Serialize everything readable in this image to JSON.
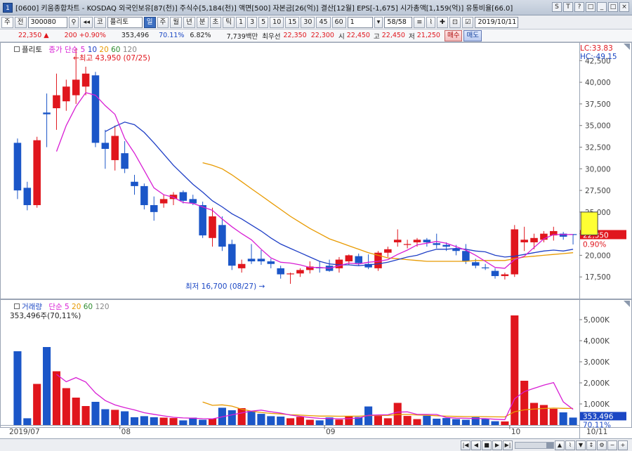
{
  "window": {
    "title": "[0600] 키움종합차트 - KOSDAQ 외국인보유[87(천)] 주식수[5,184(천)] 액면[500] 자본금[26(억)] 결산[12월] EPS[-1,675] 시가총액[1,159(억)] 유통비율[66.0]",
    "icon_label": "1",
    "controls": [
      "S",
      "T",
      "?",
      "□",
      "_",
      "□",
      "×"
    ]
  },
  "toolbar1": {
    "mode": "주",
    "market": "전",
    "code": "300080",
    "name_prefix": "코",
    "name": "플리토",
    "periods": [
      "일",
      "주",
      "월",
      "년",
      "분",
      "초",
      "틱"
    ],
    "active_period": "일",
    "intervals": [
      "1",
      "3",
      "5",
      "10",
      "15",
      "30",
      "45",
      "60"
    ],
    "custom_interval": "1",
    "count": "58/58",
    "date": "2019/10/11"
  },
  "toolbar2": {
    "price": "22,350",
    "change_arrow": "▲",
    "change": "200",
    "change_pct": "+0.90%",
    "volume": "353,496",
    "volume_ratio": "70.11%",
    "turnover": "6.82%",
    "amount": "7,739백만",
    "best_ask_label": "최우선",
    "best_ask": "22,350",
    "best_bid": "22,300",
    "open_label": "시",
    "open": "22,450",
    "high_label": "고",
    "high": "22,450",
    "low_label": "저",
    "low": "21,250",
    "buy_label": "매수",
    "sell_label": "매도"
  },
  "price_legend": {
    "name": "플리토",
    "series_title": "종가 단순",
    "periods": [
      "5",
      "10",
      "20",
      "60",
      "120"
    ],
    "period_colors": [
      "#d81ed4",
      "#1f3fc6",
      "#e89a00",
      "#2e8b2e",
      "#888888"
    ],
    "lc": "LC:33.83",
    "hc": "HC:-49.15",
    "high_note": "최고 43,950 (07/25)",
    "low_note": "최저 16,700 (08/27)",
    "last_price": "22,350",
    "last_pct": "0.90%"
  },
  "volume_legend": {
    "title": "거래량",
    "series_title": "단순",
    "periods": [
      "5",
      "20",
      "60",
      "120"
    ],
    "period_colors": [
      "#d81ed4",
      "#e89a00",
      "#2e8b2e",
      "#888888"
    ],
    "current": "353,496주(70,11%)",
    "last_volume": "353,496",
    "last_pct": "70.11%"
  },
  "x_axis": {
    "labels": [
      "2019/07",
      "08",
      "09",
      "10"
    ],
    "last_date": "10/11"
  },
  "chart_data": {
    "type": "candlestick",
    "price_axis": {
      "min": 15000,
      "max": 43500,
      "ticks": [
        17500,
        20000,
        22500,
        25000,
        27500,
        30000,
        32500,
        35000,
        37500,
        40000,
        42500
      ]
    },
    "volume_axis": {
      "min": 0,
      "max": 5500,
      "unit": "K",
      "ticks": [
        1000,
        2000,
        3000,
        4000,
        5000
      ],
      "tick_labels": [
        "1,000K",
        "2,000K",
        "3,000K",
        "4,000K",
        "5,000K"
      ]
    },
    "candles": [
      {
        "o": 33000,
        "h": 33500,
        "l": 26500,
        "c": 27500
      },
      {
        "o": 27800,
        "h": 28500,
        "l": 25200,
        "c": 25800
      },
      {
        "o": 25800,
        "h": 33700,
        "l": 25500,
        "c": 33300
      },
      {
        "o": 36500,
        "h": 38700,
        "l": 32500,
        "c": 36300
      },
      {
        "o": 37000,
        "h": 41000,
        "l": 34500,
        "c": 38500
      },
      {
        "o": 37800,
        "h": 40300,
        "l": 36700,
        "c": 39500
      },
      {
        "o": 38500,
        "h": 43950,
        "l": 37500,
        "c": 40300
      },
      {
        "o": 39500,
        "h": 41800,
        "l": 38500,
        "c": 41000
      },
      {
        "o": 40800,
        "h": 41200,
        "l": 32500,
        "c": 33000
      },
      {
        "o": 33000,
        "h": 34500,
        "l": 30000,
        "c": 32300
      },
      {
        "o": 31000,
        "h": 35000,
        "l": 29800,
        "c": 33800
      },
      {
        "o": 31800,
        "h": 33200,
        "l": 29500,
        "c": 30000
      },
      {
        "o": 28500,
        "h": 29300,
        "l": 27000,
        "c": 28000
      },
      {
        "o": 28000,
        "h": 28300,
        "l": 25300,
        "c": 25800
      },
      {
        "o": 25800,
        "h": 26800,
        "l": 24000,
        "c": 25000
      },
      {
        "o": 26000,
        "h": 27000,
        "l": 25500,
        "c": 26500
      },
      {
        "o": 26500,
        "h": 27300,
        "l": 25800,
        "c": 27000
      },
      {
        "o": 27300,
        "h": 27500,
        "l": 26000,
        "c": 26300
      },
      {
        "o": 26500,
        "h": 27000,
        "l": 25800,
        "c": 26000
      },
      {
        "o": 25800,
        "h": 26200,
        "l": 22000,
        "c": 22300
      },
      {
        "o": 22000,
        "h": 25500,
        "l": 21000,
        "c": 24500
      },
      {
        "o": 23500,
        "h": 24500,
        "l": 20500,
        "c": 21000
      },
      {
        "o": 21300,
        "h": 21800,
        "l": 18300,
        "c": 18800
      },
      {
        "o": 18500,
        "h": 19500,
        "l": 18000,
        "c": 19000
      },
      {
        "o": 19600,
        "h": 21300,
        "l": 19000,
        "c": 19300
      },
      {
        "o": 19600,
        "h": 20600,
        "l": 18900,
        "c": 19300
      },
      {
        "o": 19300,
        "h": 19600,
        "l": 18500,
        "c": 19000
      },
      {
        "o": 18500,
        "h": 18800,
        "l": 17300,
        "c": 17800
      },
      {
        "o": 17800,
        "h": 18000,
        "l": 16700,
        "c": 17900
      },
      {
        "o": 17900,
        "h": 18500,
        "l": 17500,
        "c": 18300
      },
      {
        "o": 18300,
        "h": 19300,
        "l": 17900,
        "c": 18700
      },
      {
        "o": 18600,
        "h": 19300,
        "l": 18000,
        "c": 18500
      },
      {
        "o": 18800,
        "h": 19500,
        "l": 18100,
        "c": 18200
      },
      {
        "o": 18500,
        "h": 19800,
        "l": 18000,
        "c": 19500
      },
      {
        "o": 19300,
        "h": 20100,
        "l": 18900,
        "c": 20000
      },
      {
        "o": 19900,
        "h": 20200,
        "l": 18800,
        "c": 19100
      },
      {
        "o": 19000,
        "h": 20100,
        "l": 18400,
        "c": 18600
      },
      {
        "o": 18500,
        "h": 20500,
        "l": 18200,
        "c": 20300
      },
      {
        "o": 20300,
        "h": 21000,
        "l": 19800,
        "c": 20700
      },
      {
        "o": 21500,
        "h": 23000,
        "l": 21000,
        "c": 21800
      },
      {
        "o": 21200,
        "h": 21800,
        "l": 20800,
        "c": 21300
      },
      {
        "o": 21500,
        "h": 22000,
        "l": 21000,
        "c": 21800
      },
      {
        "o": 21800,
        "h": 22000,
        "l": 21000,
        "c": 21500
      },
      {
        "o": 21400,
        "h": 22500,
        "l": 20800,
        "c": 21200
      },
      {
        "o": 21200,
        "h": 21500,
        "l": 20500,
        "c": 21000
      },
      {
        "o": 20800,
        "h": 21200,
        "l": 20000,
        "c": 20500
      },
      {
        "o": 20500,
        "h": 21300,
        "l": 19000,
        "c": 19300
      },
      {
        "o": 19200,
        "h": 19600,
        "l": 18500,
        "c": 18800
      },
      {
        "o": 18600,
        "h": 19000,
        "l": 18300,
        "c": 18500
      },
      {
        "o": 18200,
        "h": 18500,
        "l": 17300,
        "c": 17600
      },
      {
        "o": 17600,
        "h": 18000,
        "l": 17200,
        "c": 17800
      },
      {
        "o": 17800,
        "h": 23500,
        "l": 17500,
        "c": 23000
      },
      {
        "o": 21500,
        "h": 23300,
        "l": 20500,
        "c": 21800
      },
      {
        "o": 21500,
        "h": 22500,
        "l": 20700,
        "c": 22000
      },
      {
        "o": 21800,
        "h": 22800,
        "l": 21500,
        "c": 22500
      },
      {
        "o": 22300,
        "h": 23300,
        "l": 21700,
        "c": 22800
      },
      {
        "o": 22500,
        "h": 22700,
        "l": 21800,
        "c": 22150
      },
      {
        "o": 22450,
        "h": 22450,
        "l": 21250,
        "c": 22350
      }
    ],
    "ma5": [
      null,
      null,
      null,
      null,
      32000,
      35000,
      37200,
      38800,
      38500,
      37300,
      36300,
      33500,
      31800,
      29800,
      27800,
      27000,
      26700,
      26100,
      26000,
      25600,
      25200,
      24200,
      23300,
      22500,
      21800,
      20700,
      19700,
      19200,
      19100,
      18900,
      18600,
      18600,
      18500,
      18800,
      19100,
      19000,
      19200,
      19300,
      19500,
      20100,
      20600,
      21200,
      21400,
      21600,
      21400,
      21000,
      20600,
      20000,
      19300,
      18600,
      18500,
      19500,
      19900,
      20900,
      21900,
      22400,
      22400,
      22400
    ],
    "ma10": [
      null,
      null,
      null,
      null,
      null,
      null,
      null,
      null,
      null,
      34300,
      34900,
      35400,
      35100,
      34200,
      33000,
      31700,
      30400,
      29300,
      28200,
      27300,
      26300,
      25600,
      24800,
      24200,
      23500,
      22800,
      22000,
      21300,
      20800,
      20300,
      19800,
      19300,
      19000,
      18900,
      18900,
      18800,
      18900,
      19000,
      19200,
      19500,
      19800,
      20000,
      20400,
      20700,
      20700,
      20800,
      20700,
      20500,
      20400,
      20000,
      19800,
      19900,
      20100,
      20300,
      20500,
      20600,
      20500,
      20700
    ],
    "ma20": [
      null,
      null,
      null,
      null,
      null,
      null,
      null,
      null,
      null,
      null,
      null,
      null,
      null,
      null,
      null,
      null,
      null,
      null,
      null,
      30700,
      30400,
      30000,
      29300,
      28500,
      27700,
      26900,
      26100,
      25300,
      24500,
      23800,
      23100,
      22500,
      21900,
      21500,
      21100,
      20700,
      20300,
      20000,
      19700,
      19600,
      19500,
      19400,
      19300,
      19300,
      19300,
      19300,
      19300,
      19400,
      19400,
      19400,
      19400,
      19600,
      19800,
      19900,
      20000,
      20100,
      20200,
      20300
    ],
    "volumes": [
      3500,
      320,
      1950,
      3700,
      2550,
      1750,
      1300,
      900,
      1100,
      750,
      720,
      650,
      370,
      420,
      370,
      350,
      330,
      220,
      350,
      250,
      300,
      820,
      700,
      800,
      680,
      530,
      420,
      400,
      320,
      390,
      250,
      220,
      360,
      260,
      430,
      380,
      880,
      430,
      320,
      1050,
      430,
      280,
      440,
      300,
      330,
      280,
      250,
      370,
      290,
      180,
      170,
      5200,
      2100,
      1050,
      950,
      770,
      600,
      353
    ]
  }
}
